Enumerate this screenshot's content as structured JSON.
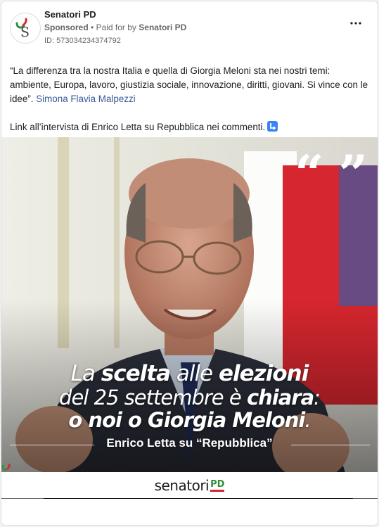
{
  "advertiser": {
    "name": "Senatori PD",
    "sponsored_label": "Sponsored",
    "paid_for_prefix": "Paid for by",
    "paid_for_name": "Senatori PD",
    "ad_id": "ID: 573034234374792"
  },
  "post": {
    "quote_text": "“La differenza tra la nostra Italia e quella di Giorgia Meloni sta nei nostri temi: ambiente, Europa, lavoro, giustizia sociale, innovazione, diritti, giovani. Si vince con le idee”.",
    "mention": "Simona Flavia Malpezzi",
    "link_text": "Link all’intervista di Enrico Letta su Repubblica nei commenti."
  },
  "image": {
    "quote_marks": "“ ”",
    "headline_line1_a": "La ",
    "headline_line1_b": "scelta",
    "headline_line1_c": " alle ",
    "headline_line1_d": "elezioni",
    "headline_line2_a": "del 25 settembre è ",
    "headline_line2_b": "chiara",
    "headline_line2_c": ":",
    "headline_line3_a": "o noi o Giorgia Meloni",
    "headline_line3_b": ".",
    "caption": "Enrico Letta su “Repubblica”",
    "brand": "senatori",
    "brand_suffix": "PD"
  },
  "colors": {
    "link": "#385898",
    "meta": "#65676b",
    "flag_green": "#2f8f3c",
    "flag_red": "#d6262f",
    "emoji_blue": "#3b82f6"
  },
  "icons": {
    "more": "more-horizontal-icon",
    "arrow": "arrow-down-right-icon"
  }
}
